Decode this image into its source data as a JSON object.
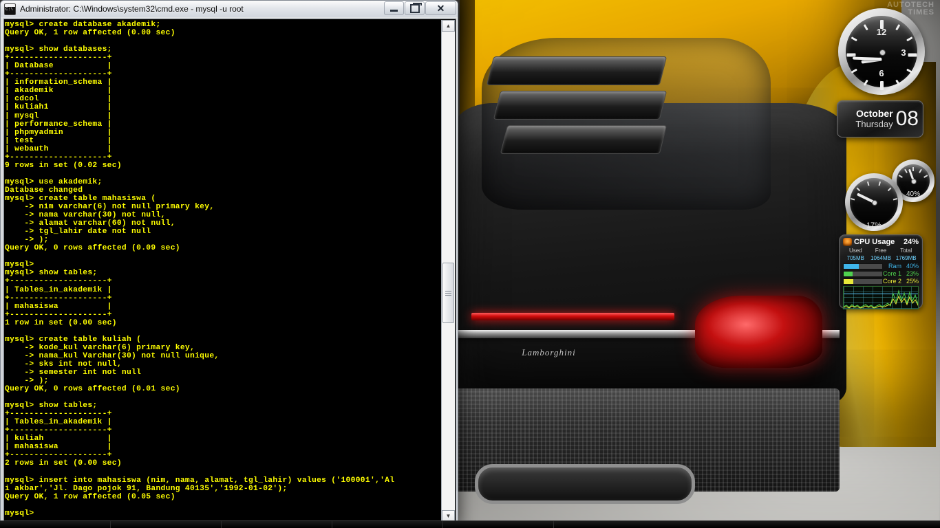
{
  "window": {
    "title": "Administrator: C:\\Windows\\system32\\cmd.exe - mysql  -u root",
    "icon": "cmd-console-icon",
    "buttons": {
      "minimize": "minimize",
      "restore": "restore",
      "close": "✕"
    },
    "scrollbar": {
      "up": "▲",
      "down": "▼"
    }
  },
  "console": {
    "foreground": "#ffff00",
    "background": "#000000",
    "text": "mysql> create database akademik;\nQuery OK, 1 row affected (0.00 sec)\n\nmysql> show databases;\n+--------------------+\n| Database           |\n+--------------------+\n| information_schema |\n| akademik           |\n| cdcol              |\n| kuliah1            |\n| mysql              |\n| performance_schema |\n| phpmyadmin         |\n| test               |\n| webauth            |\n+--------------------+\n9 rows in set (0.02 sec)\n\nmysql> use akademik;\nDatabase changed\nmysql> create table mahasiswa (\n    -> nim varchar(6) not null primary key,\n    -> nama varchar(30) not null,\n    -> alamat varchar(60) not null,\n    -> tgl_lahir date not null\n    -> );\nQuery OK, 0 rows affected (0.09 sec)\n\nmysql>\nmysql> show tables;\n+--------------------+\n| Tables_in_akademik |\n+--------------------+\n| mahasiswa          |\n+--------------------+\n1 row in set (0.00 sec)\n\nmysql> create table kuliah (\n    -> kode_kul varchar(6) primary key,\n    -> nama_kul Varchar(30) not null unique,\n    -> sks int not null,\n    -> semester int not null\n    -> );\nQuery OK, 0 rows affected (0.01 sec)\n\nmysql> show tables;\n+--------------------+\n| Tables_in_akademik |\n+--------------------+\n| kuliah             |\n| mahasiswa          |\n+--------------------+\n2 rows in set (0.00 sec)\n\nmysql> insert into mahasiswa (nim, nama, alamat, tgl_lahir) values ('100001','Al\ni akbar','Jl. Dago pojok 91, Bandung 40135','1992-01-02');\nQuery OK, 1 row affected (0.05 sec)\n\nmysql>"
  },
  "gadgets": {
    "clock": {
      "name": "analog-clock",
      "numerals": [
        "12",
        "3",
        "6"
      ],
      "hour_angle": 262,
      "minute_angle": 272
    },
    "calendar": {
      "month": "October",
      "weekday": "Thursday",
      "date": "08"
    },
    "gauges": [
      {
        "name": "cpu-gauge",
        "label": "17%",
        "value": 17,
        "angle": -64
      },
      {
        "name": "ram-gauge",
        "label": "40%",
        "value": 40,
        "angle": -20
      }
    ],
    "cpu_meter": {
      "title": "CPU Usage",
      "total_pct": "24%",
      "memory_headers": [
        "Used",
        "Free",
        "Total"
      ],
      "memory_values": [
        "705MB",
        "1064MB",
        "1769MB"
      ],
      "bars": [
        {
          "name": "Ram",
          "value": "40%",
          "pct": 40,
          "color": "#3fb5ea"
        },
        {
          "name": "Core 1",
          "value": "23%",
          "pct": 23,
          "color": "#4fd14f"
        },
        {
          "name": "Core 2",
          "value": "25%",
          "pct": 25,
          "color": "#e8e83a"
        }
      ]
    }
  },
  "wallpaper": {
    "watermark": "AUTOTECH\nTIMES",
    "car_badge": "Lamborghini"
  }
}
